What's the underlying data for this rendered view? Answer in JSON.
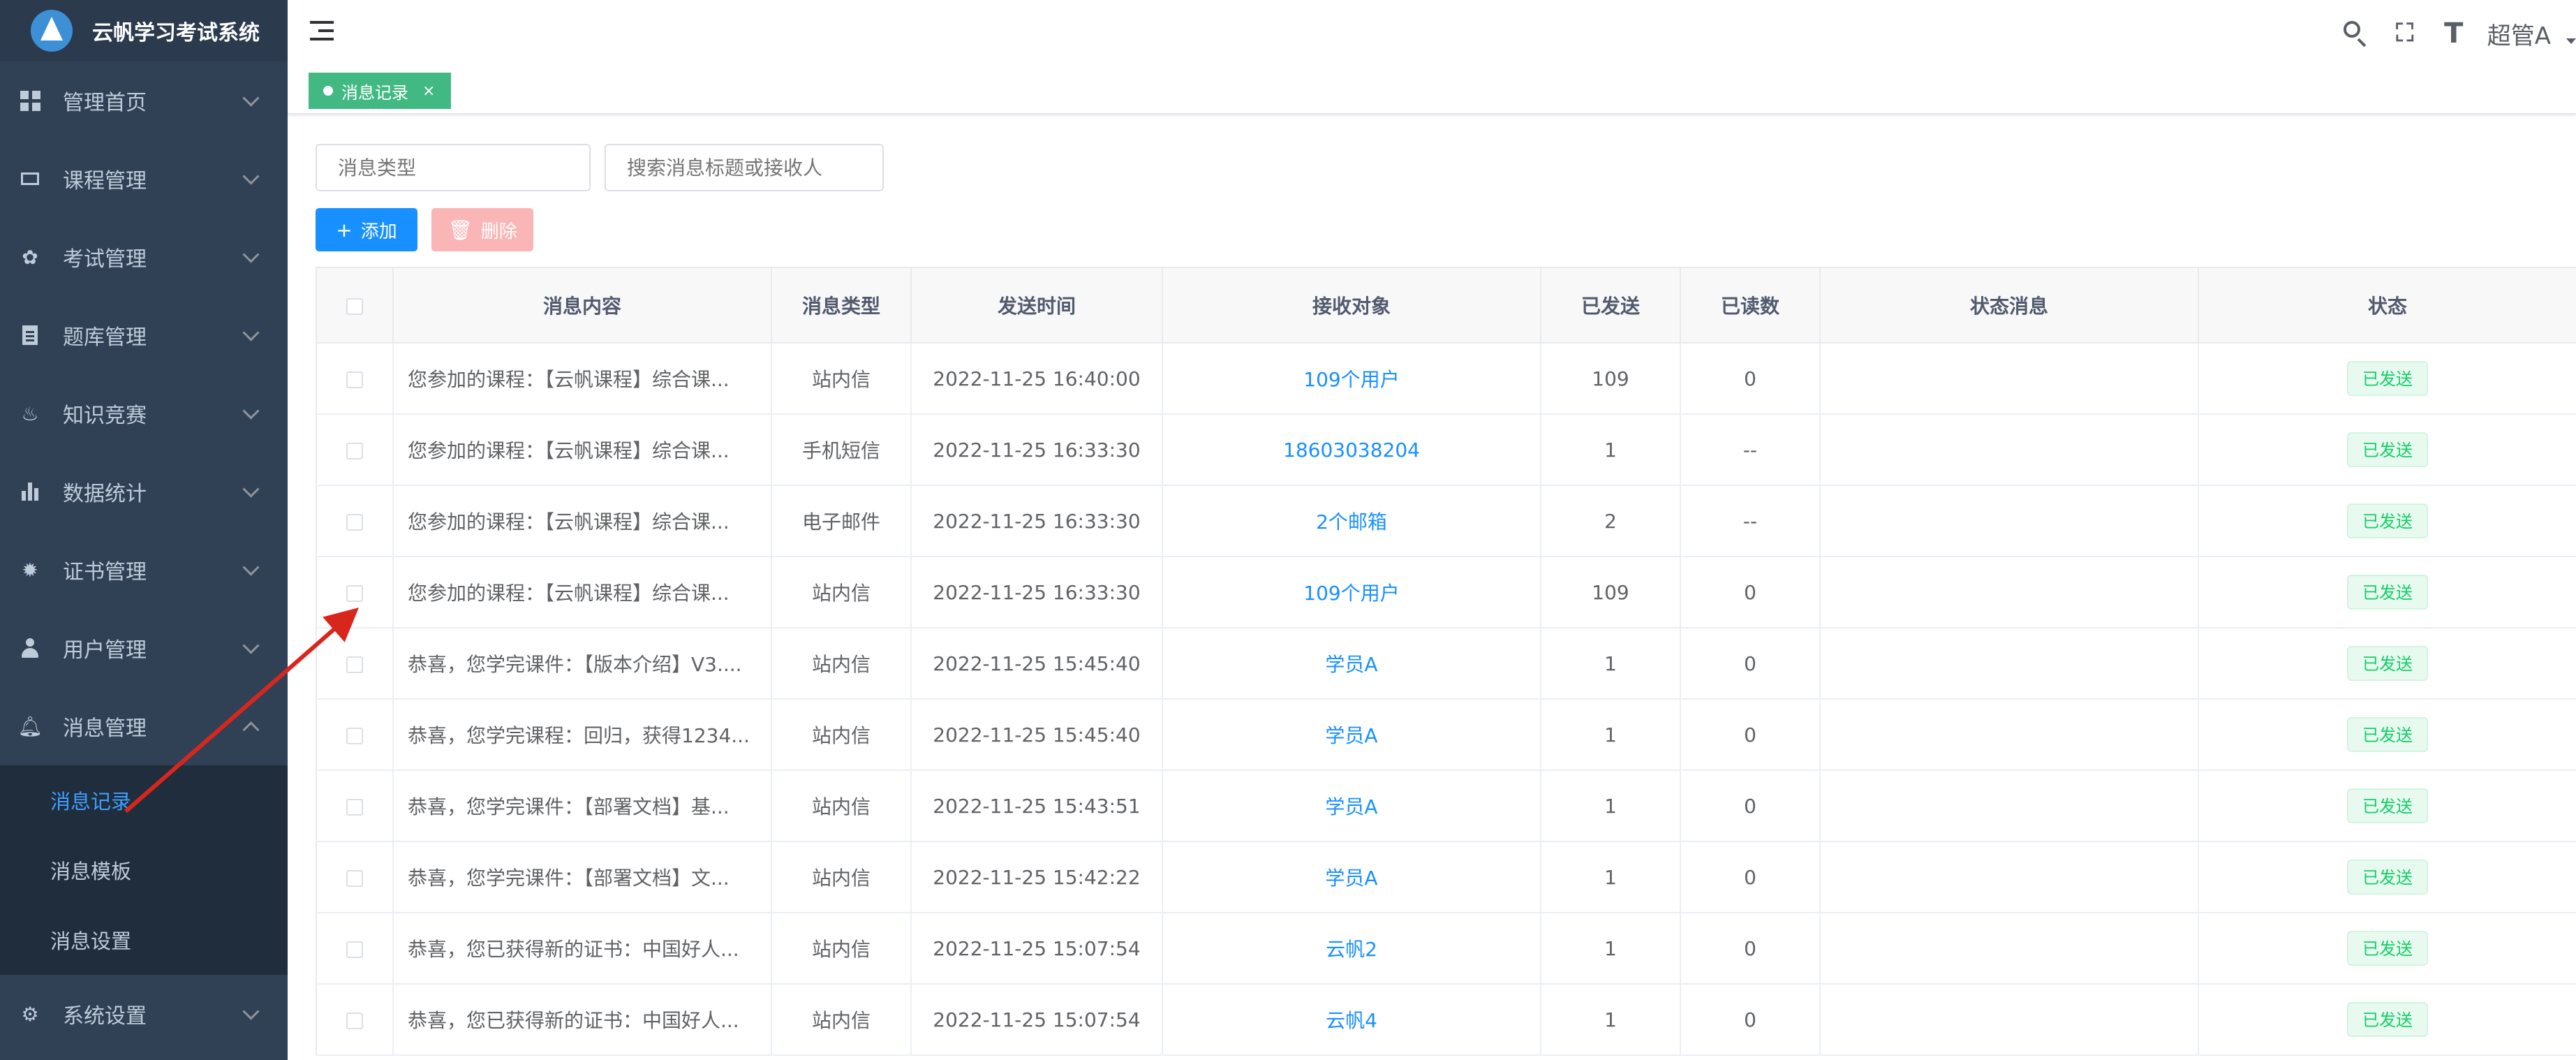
{
  "app": {
    "title": "云帆学习考试系统"
  },
  "sidebar": {
    "items": [
      {
        "label": "管理首页",
        "icon": "dashboard-icon"
      },
      {
        "label": "课程管理",
        "icon": "monitor-icon"
      },
      {
        "label": "考试管理",
        "icon": "exam-icon"
      },
      {
        "label": "题库管理",
        "icon": "document-icon"
      },
      {
        "label": "知识竞赛",
        "icon": "fire-icon"
      },
      {
        "label": "数据统计",
        "icon": "bar-chart-icon"
      },
      {
        "label": "证书管理",
        "icon": "certificate-icon"
      },
      {
        "label": "用户管理",
        "icon": "user-icon"
      },
      {
        "label": "消息管理",
        "icon": "bell-icon",
        "expanded": true
      },
      {
        "label": "系统设置",
        "icon": "gear-icon"
      }
    ],
    "submenu": [
      {
        "label": "消息记录",
        "active": true
      },
      {
        "label": "消息模板"
      },
      {
        "label": "消息设置"
      }
    ]
  },
  "header": {
    "username": "超管A"
  },
  "tags": [
    {
      "label": "消息记录",
      "close": "×",
      "active": true
    }
  ],
  "filters": {
    "type_placeholder": "消息类型",
    "search_placeholder": "搜索消息标题或接收人"
  },
  "toolbar": {
    "add_label": "添加",
    "delete_label": "删除",
    "add_icon": "+",
    "delete_icon": "🗑"
  },
  "table": {
    "columns": [
      "消息内容",
      "消息类型",
      "发送时间",
      "接收对象",
      "已发送",
      "已读数",
      "状态消息",
      "状态"
    ],
    "rows": [
      {
        "content": "您参加的课程：【云帆课程】综合课...",
        "type": "站内信",
        "time": "2022-11-25 16:40:00",
        "receiver": "109个用户",
        "sent": "109",
        "read": "0",
        "msg": "",
        "status": "已发送"
      },
      {
        "content": "您参加的课程：【云帆课程】综合课...",
        "type": "手机短信",
        "time": "2022-11-25 16:33:30",
        "receiver": "18603038204",
        "sent": "1",
        "read": "--",
        "msg": "",
        "status": "已发送"
      },
      {
        "content": "您参加的课程：【云帆课程】综合课...",
        "type": "电子邮件",
        "time": "2022-11-25 16:33:30",
        "receiver": "2个邮箱",
        "sent": "2",
        "read": "--",
        "msg": "",
        "status": "已发送"
      },
      {
        "content": "您参加的课程：【云帆课程】综合课...",
        "type": "站内信",
        "time": "2022-11-25 16:33:30",
        "receiver": "109个用户",
        "sent": "109",
        "read": "0",
        "msg": "",
        "status": "已发送"
      },
      {
        "content": "恭喜，您学完课件：【版本介绍】V3....",
        "type": "站内信",
        "time": "2022-11-25 15:45:40",
        "receiver": "学员A",
        "sent": "1",
        "read": "0",
        "msg": "",
        "status": "已发送"
      },
      {
        "content": "恭喜，您学完课程：回归，获得1234...",
        "type": "站内信",
        "time": "2022-11-25 15:45:40",
        "receiver": "学员A",
        "sent": "1",
        "read": "0",
        "msg": "",
        "status": "已发送"
      },
      {
        "content": "恭喜，您学完课件：【部署文档】基...",
        "type": "站内信",
        "time": "2022-11-25 15:43:51",
        "receiver": "学员A",
        "sent": "1",
        "read": "0",
        "msg": "",
        "status": "已发送"
      },
      {
        "content": "恭喜，您学完课件：【部署文档】文...",
        "type": "站内信",
        "time": "2022-11-25 15:42:22",
        "receiver": "学员A",
        "sent": "1",
        "read": "0",
        "msg": "",
        "status": "已发送"
      },
      {
        "content": "恭喜，您已获得新的证书：中国好人...",
        "type": "站内信",
        "time": "2022-11-25 15:07:54",
        "receiver": "云帆2",
        "sent": "1",
        "read": "0",
        "msg": "",
        "status": "已发送"
      },
      {
        "content": "恭喜，您已获得新的证书：中国好人...",
        "type": "站内信",
        "time": "2022-11-25 15:07:54",
        "receiver": "云帆4",
        "sent": "1",
        "read": "0",
        "msg": "",
        "status": "已发送"
      }
    ]
  },
  "colors": {
    "sidebar_bg": "#304156",
    "submenu_bg": "#1f2d3d",
    "active_menu": "#409eff",
    "tag_green": "#42b983",
    "primary": "#1890ff",
    "danger_disabled": "#fab6b6",
    "status_green": "#13ce66",
    "annotation_arrow": "#d9261c"
  }
}
